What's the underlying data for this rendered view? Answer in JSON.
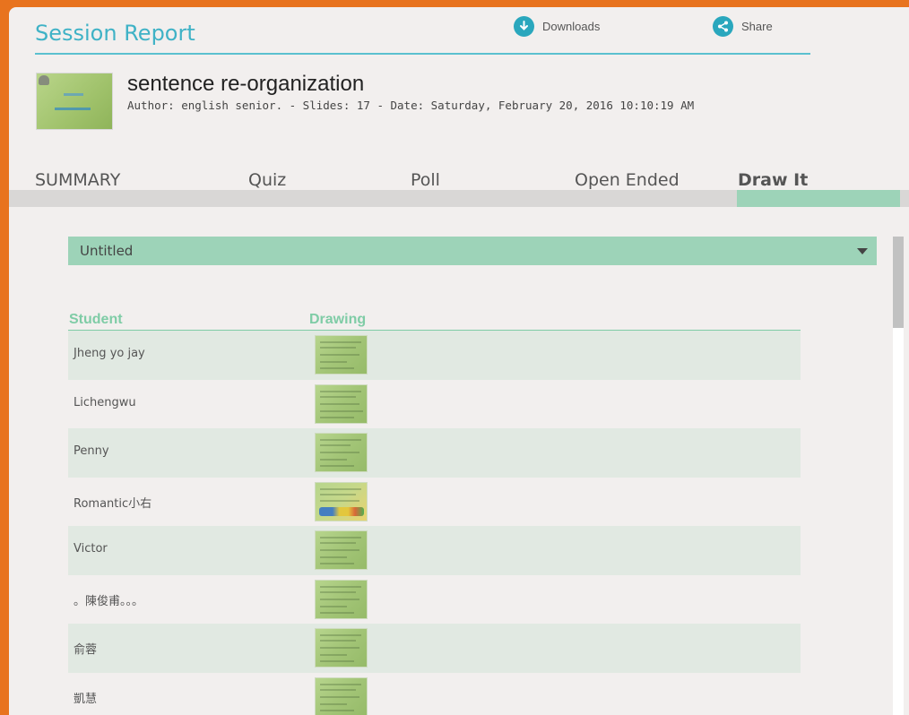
{
  "header": {
    "title": "Session Report",
    "downloads_label": "Downloads",
    "share_label": "Share"
  },
  "deck": {
    "name": "sentence re-organization",
    "meta": "Author: english senior. - Slides: 17 - Date: Saturday, February 20, 2016 10:10:19 AM"
  },
  "tabs": [
    {
      "label": "SUMMARY"
    },
    {
      "label": "Quiz"
    },
    {
      "label": "Poll"
    },
    {
      "label": "Open Ended"
    },
    {
      "label": "Draw It",
      "active": true
    }
  ],
  "slide_select": {
    "value": "Untitled"
  },
  "table": {
    "headers": {
      "student": "Student",
      "drawing": "Drawing"
    },
    "rows": [
      {
        "student": "Jheng yo jay",
        "drawing": "drawing-thumbnail"
      },
      {
        "student": "Lichengwu",
        "drawing": "drawing-thumbnail"
      },
      {
        "student": "Penny",
        "drawing": "drawing-thumbnail"
      },
      {
        "student": "Romantic小右",
        "drawing": "drawing-thumbnail-colored"
      },
      {
        "student": "Victor",
        "drawing": "drawing-thumbnail"
      },
      {
        "student": "。陳俊甫。。。",
        "drawing": "drawing-thumbnail"
      },
      {
        "student": "俞蓉",
        "drawing": "drawing-thumbnail"
      },
      {
        "student": "凱慧",
        "drawing": "drawing-thumbnail"
      }
    ]
  },
  "colors": {
    "frame": "#e8731e",
    "title": "#3fb2c6",
    "accent_green": "#9dd3b8",
    "header_green": "#7fcca6"
  }
}
